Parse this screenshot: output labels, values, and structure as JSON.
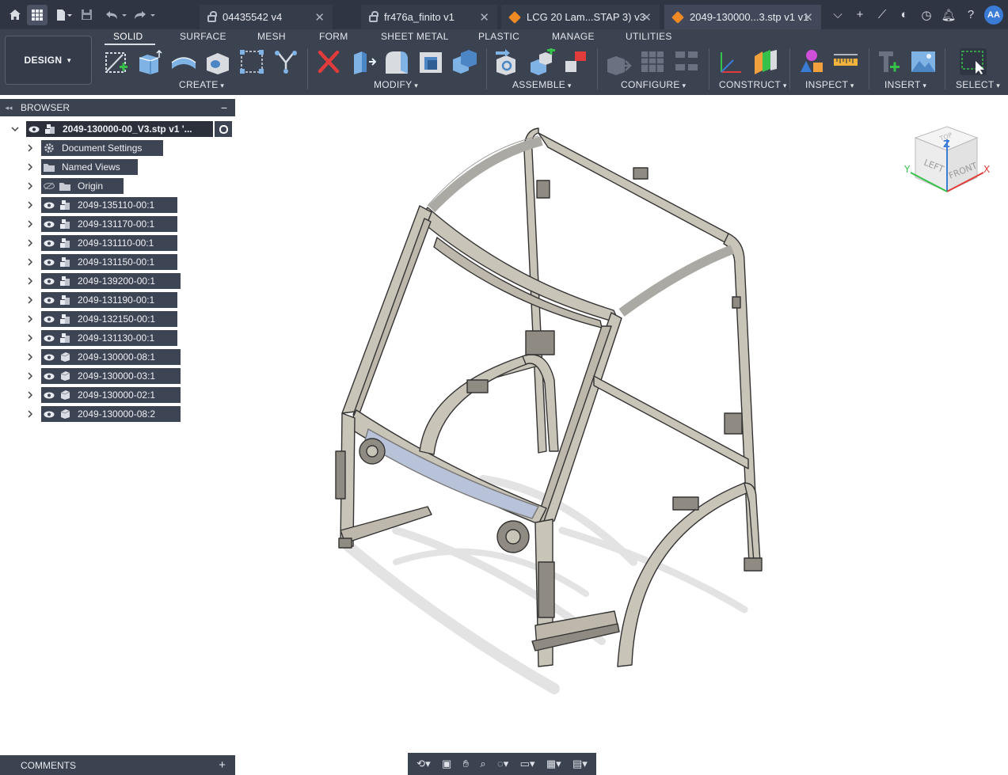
{
  "tabs": [
    {
      "label": "04435542 v4",
      "locked": true,
      "active": false
    },
    {
      "label": "fr476a_finito v1",
      "locked": true,
      "active": false
    },
    {
      "label": "LCG 20 Lam...STAP 3) v3",
      "locked": false,
      "active": false
    },
    {
      "label": "2049-130000...3.stp v1 v1",
      "locked": false,
      "active": true
    }
  ],
  "user": {
    "initials": "AA"
  },
  "toolbar": {
    "design_label": "DESIGN",
    "workspaces": [
      "SOLID",
      "SURFACE",
      "MESH",
      "FORM",
      "SHEET METAL",
      "PLASTIC",
      "MANAGE",
      "UTILITIES"
    ],
    "groups": [
      "CREATE",
      "MODIFY",
      "ASSEMBLE",
      "CONFIGURE",
      "CONSTRUCT",
      "INSPECT",
      "INSERT",
      "SELECT"
    ]
  },
  "browser": {
    "title": "BROWSER",
    "root": "2049-130000-00_V3.stp v1 '...",
    "items": [
      {
        "label": "Document Settings",
        "icon": "gear-icon"
      },
      {
        "label": "Named Views",
        "icon": "folder-icon"
      },
      {
        "label": "Origin",
        "icon": "folder-icon"
      },
      {
        "label": "2049-135110-00:1",
        "icon": "component-icon"
      },
      {
        "label": "2049-131170-00:1",
        "icon": "component-icon"
      },
      {
        "label": "2049-131110-00:1",
        "icon": "component-icon"
      },
      {
        "label": "2049-131150-00:1",
        "icon": "component-icon"
      },
      {
        "label": "2049-139200-00:1",
        "icon": "component-icon"
      },
      {
        "label": "2049-131190-00:1",
        "icon": "component-icon"
      },
      {
        "label": "2049-132150-00:1",
        "icon": "component-icon"
      },
      {
        "label": "2049-131130-00:1",
        "icon": "component-icon"
      },
      {
        "label": "2049-130000-08:1",
        "icon": "body-icon"
      },
      {
        "label": "2049-130000-03:1",
        "icon": "body-icon"
      },
      {
        "label": "2049-130000-02:1",
        "icon": "body-icon"
      },
      {
        "label": "2049-130000-08:2",
        "icon": "body-icon"
      }
    ]
  },
  "comments": {
    "title": "COMMENTS"
  },
  "viewcube": {
    "top": "TOP",
    "left": "LEFT",
    "front": "FRONT",
    "x": "X",
    "y": "Y",
    "z": "Z"
  },
  "colors": {
    "frame": "#c9c4b8",
    "frame_edge": "#3a3a3a",
    "accent_blue": "#3a7bd5",
    "toolbar_bg": "#3b4250"
  }
}
